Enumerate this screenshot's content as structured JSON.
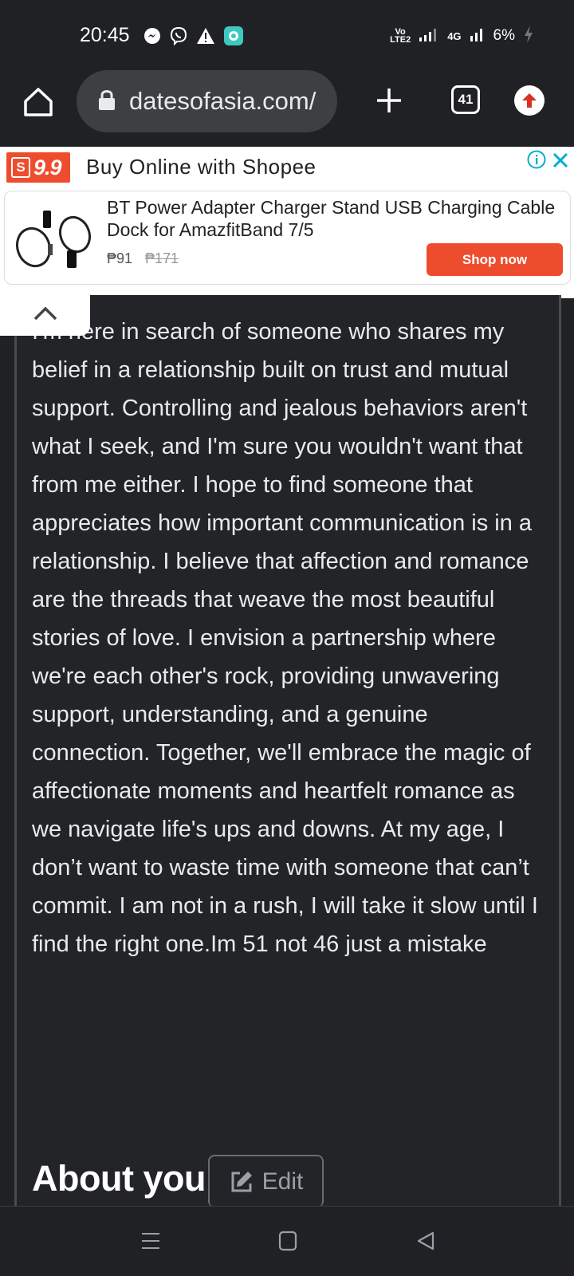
{
  "status_bar": {
    "time": "20:45",
    "volte": "VoD LTE2",
    "network": "4G",
    "battery": "6%",
    "icons": [
      "messenger-icon",
      "viber-icon",
      "alert-icon",
      "app-notification-icon",
      "signal-icon",
      "battery-charging-icon"
    ]
  },
  "browser": {
    "url": "datesofasia.com/",
    "tab_count": "41"
  },
  "ad": {
    "logo_text": "9.9",
    "logo_bag_letter": "S",
    "headline": "Buy Online with Shopee",
    "product_title": "BT Power Adapter Charger Stand USB Charging Cable Dock for AmazfitBand 7/5",
    "price": "₱91",
    "old_price": "₱171",
    "cta": "Shop now",
    "accent_color": "#ee4d2d"
  },
  "profile": {
    "bio_text": "I'm here in search of someone who shares my belief in a relationship built on trust and mutual support. Controlling and jealous behaviors aren't what I seek, and I'm sure you wouldn't want that from me either. I hope to find someone that appreciates how important communication is in a relationship. I believe that affection and romance are the threads that weave the most beautiful stories of love. I envision a partnership where we're each other's rock, providing unwavering support, understanding, and a genuine connection. Together, we'll embrace the magic of affectionate moments and heartfelt romance as we navigate life's ups and downs. At my age, I don’t want to waste time with someone that can’t commit. I am not in a rush, I will take it slow until I find the right one.Im 51 not 46 just a mistake",
    "about_heading": "About you",
    "edit_label": "Edit"
  }
}
